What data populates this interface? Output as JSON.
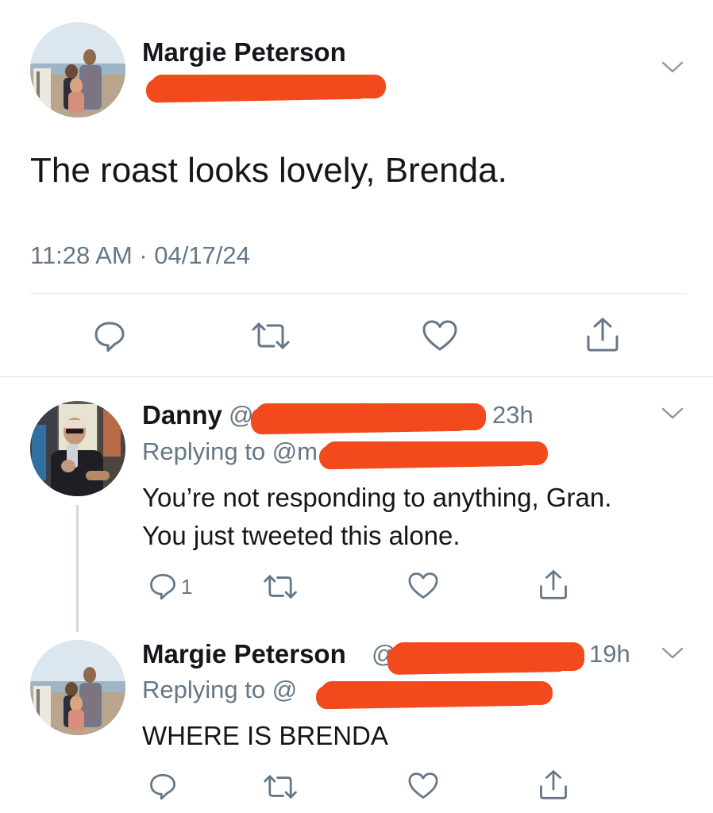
{
  "main_tweet": {
    "author_name": "Margie Peterson",
    "text": "The roast looks lovely, Brenda.",
    "timestamp": "11:28 AM · 04/17/24",
    "actions": [
      "reply-icon",
      "retweet-icon",
      "like-icon",
      "share-icon"
    ]
  },
  "replies": [
    {
      "author_name": "Danny",
      "handle_prefix": "@d",
      "time": "23h",
      "replying_to": "Replying to @m",
      "text_line1": "You’re not responding to anything, Gran.",
      "text_line2": "You just tweeted this alone.",
      "reply_count": "1"
    },
    {
      "author_name": "Margie Peterson",
      "handle_prefix": "@",
      "time": "19h",
      "replying_to": "Replying to @",
      "text": "WHERE IS BRENDA",
      "reply_count": ""
    }
  ],
  "colors": {
    "icon": "#657786",
    "redaction": "#f2491d",
    "divider": "#e1e8ed"
  }
}
